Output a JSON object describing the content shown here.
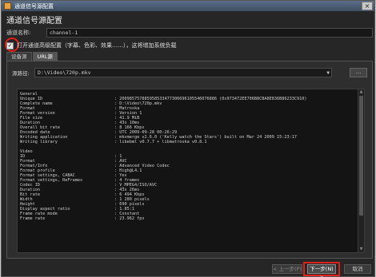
{
  "window": {
    "title": "通道信号源配置",
    "close_glyph": "×"
  },
  "heading": "通道信号源配置",
  "channel": {
    "label": "通道名称:",
    "value": "channel-1"
  },
  "option": {
    "checked": true,
    "check_glyph": "✓",
    "label": "打开通道高级配置（字幕、色彩、效果……），这将增加系统负载"
  },
  "tabs": [
    {
      "label": "设备源",
      "active": false
    },
    {
      "label": "URL源",
      "active": true
    }
  ],
  "source": {
    "label": "源路径:",
    "value": "D:\\Video\\720p.mkv",
    "dropdown_glyph": "▼",
    "browse_label": "..."
  },
  "media_info": [
    {
      "key": "General",
      "value": ""
    },
    {
      "key": "Unique ID",
      "value": ": 200985757885958533477306696105546076886 (0x973472EE706B8CBA8E836B86233C910)"
    },
    {
      "key": "Complete name",
      "value": ": D:\\Video\\720p.mkv"
    },
    {
      "key": "Format",
      "value": ": Matroska"
    },
    {
      "key": "Format version",
      "value": ": Version 1"
    },
    {
      "key": "File size",
      "value": ": 41.9 MiB"
    },
    {
      "key": "Duration",
      "value": ": 43s 10ms"
    },
    {
      "key": "Overall bit rate",
      "value": ": 8 166 Kbps"
    },
    {
      "key": "Encoded date",
      "value": ": UTC 2009-09-28 00:26:29"
    },
    {
      "key": "Writing application",
      "value": ": mkvmerge v2.6.0 ('Kelly watch the Stars') built on Mar 24 2009 15:23:17"
    },
    {
      "key": "Writing library",
      "value": ": libebml v0.7.7 + libmatroska v0.8.1"
    },
    {
      "key": "",
      "value": ""
    },
    {
      "key": "Video",
      "value": ""
    },
    {
      "key": "ID",
      "value": ": 1"
    },
    {
      "key": "Format",
      "value": ": AVC"
    },
    {
      "key": "Format/Info",
      "value": ": Advanced Video Codec"
    },
    {
      "key": "Format profile",
      "value": ": High@L4.1"
    },
    {
      "key": "Format settings, CABAC",
      "value": ": Yes"
    },
    {
      "key": "Format settings, ReFrames",
      "value": ": 4 frames"
    },
    {
      "key": "Codec ID",
      "value": ": V_MPEG4/ISO/AVC"
    },
    {
      "key": "Duration",
      "value": ": 43s 26ms"
    },
    {
      "key": "Bit rate",
      "value": ": 6 494 Kbps"
    },
    {
      "key": "Width",
      "value": ": 1 280 pixels"
    },
    {
      "key": "Height",
      "value": ": 690 pixels"
    },
    {
      "key": "Display aspect ratio",
      "value": ": 1.85:1"
    },
    {
      "key": "Frame rate mode",
      "value": ": Constant"
    },
    {
      "key": "Frame rate",
      "value": ": 23.962 fps"
    }
  ],
  "scrollbar": {
    "up_glyph": "▲",
    "down_glyph": "▼"
  },
  "buttons": {
    "prev": "< 上一步(P)",
    "next": "下一步(N) >",
    "cancel": "取消"
  },
  "colors": {
    "highlight": "#e0201a",
    "window_bg": "#262626",
    "titlebar": "#4a5d75"
  }
}
